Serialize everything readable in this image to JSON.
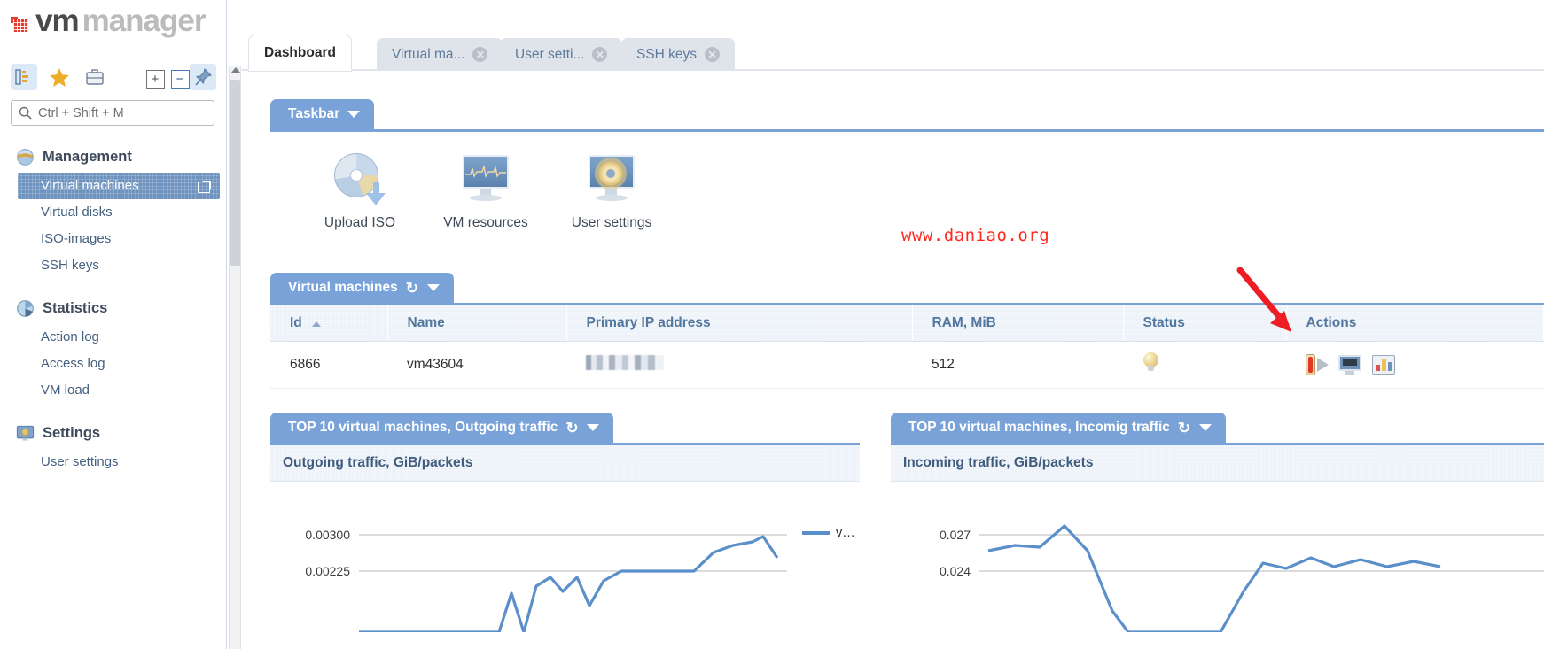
{
  "brand": {
    "vm": "vm",
    "manager": "manager"
  },
  "sidebar": {
    "search": {
      "placeholder": "Ctrl + Shift + M",
      "value": ""
    },
    "toolbar": [
      {
        "name": "list-view-icon",
        "label": "List"
      },
      {
        "name": "favorites-star-icon",
        "label": "Favorites"
      },
      {
        "name": "briefcase-icon",
        "label": "Briefcase"
      },
      {
        "name": "expand-all-icon",
        "label": "+"
      },
      {
        "name": "collapse-all-icon",
        "label": "−"
      },
      {
        "name": "pin-icon",
        "label": "Pin"
      }
    ],
    "groups": [
      {
        "title": "Management",
        "icon": "globe-icon",
        "items": [
          {
            "label": "Virtual machines",
            "active": true,
            "trailing_icon": "external-link-icon"
          },
          {
            "label": "Virtual disks",
            "active": false
          },
          {
            "label": "ISO-images",
            "active": false
          },
          {
            "label": "SSH keys",
            "active": false
          }
        ]
      },
      {
        "title": "Statistics",
        "icon": "pie-chart-icon",
        "items": [
          {
            "label": "Action log",
            "active": false
          },
          {
            "label": "Access log",
            "active": false
          },
          {
            "label": "VM load",
            "active": false
          }
        ]
      },
      {
        "title": "Settings",
        "icon": "monitor-gear-icon",
        "items": [
          {
            "label": "User settings",
            "active": false
          }
        ]
      }
    ]
  },
  "tabs": [
    {
      "label": "Dashboard",
      "active": true,
      "closable": false
    },
    {
      "label": "Virtual ma...",
      "active": false,
      "closable": true
    },
    {
      "label": "User setti...",
      "active": false,
      "closable": true
    },
    {
      "label": "SSH keys",
      "active": false,
      "closable": true
    }
  ],
  "taskbar": {
    "title": "Taskbar",
    "items": [
      {
        "label": "Upload ISO",
        "icon": "cd-download-icon"
      },
      {
        "label": "VM resources",
        "icon": "monitor-ecg-icon"
      },
      {
        "label": "User settings",
        "icon": "monitor-gear-icon"
      }
    ]
  },
  "watermark": "www.daniao.org",
  "vm_panel": {
    "title": "Virtual machines",
    "columns": [
      {
        "label": "Id",
        "sorted": "asc"
      },
      {
        "label": "Name"
      },
      {
        "label": "Primary IP address"
      },
      {
        "label": "RAM, MiB"
      },
      {
        "label": "Status"
      },
      {
        "label": "Actions"
      }
    ],
    "rows": [
      {
        "id": "6866",
        "name": "vm43604",
        "ip": "",
        "ram": "512",
        "status_icon": "lightbulb-icon",
        "actions": [
          "power-icon",
          "vnc-console-icon",
          "statistics-icon"
        ]
      }
    ]
  },
  "charts": {
    "outgoing": {
      "title": "TOP 10 virtual machines, Outgoing traffic",
      "subtitle": "Outgoing traffic, GiB/packets",
      "legend": "v…"
    },
    "incoming": {
      "title": "TOP 10 virtual machines, Incomig traffic",
      "subtitle": "Incoming traffic, GiB/packets"
    }
  },
  "chart_data": [
    {
      "type": "line",
      "title": "TOP 10 virtual machines, Outgoing traffic",
      "subtitle": "Outgoing traffic, GiB/packets",
      "ylabel": "Outgoing traffic, GiB/packets",
      "xlabel": "",
      "yticks": [
        "0.00300",
        "0.00225"
      ],
      "ylim": [
        0.0015,
        0.00325
      ],
      "grid": true,
      "legend_position": "right",
      "series": [
        {
          "name": "v…",
          "color": "#5b8fc9",
          "values": [
            0.0015,
            0.0015,
            0.0015,
            0.0015,
            0.0015,
            0.0015,
            0.0015,
            0.0019,
            0.0015,
            0.00195,
            0.00205,
            0.0019,
            0.00205,
            0.00175,
            0.002,
            0.00215,
            0.00222,
            0.00222,
            0.00222,
            0.0024,
            0.00252,
            0.00252,
            0.00262,
            0.0024
          ]
        }
      ]
    },
    {
      "type": "line",
      "title": "TOP 10 virtual machines, Incomig traffic",
      "subtitle": "Incoming traffic, GiB/packets",
      "ylabel": "Incoming traffic, GiB/packets",
      "xlabel": "",
      "yticks": [
        "0.027",
        "0.024"
      ],
      "ylim": [
        0.0205,
        0.0285
      ],
      "grid": true,
      "legend_position": "right",
      "series": [
        {
          "name": "",
          "color": "#5b8fc9",
          "values": [
            0.0258,
            0.0266,
            0.0263,
            0.0272,
            0.0258,
            0.0232,
            0.0215,
            0.0212,
            0.0225,
            0.0247,
            0.0244,
            0.0248,
            0.0243,
            0.0247,
            0.0244
          ]
        }
      ]
    }
  ]
}
